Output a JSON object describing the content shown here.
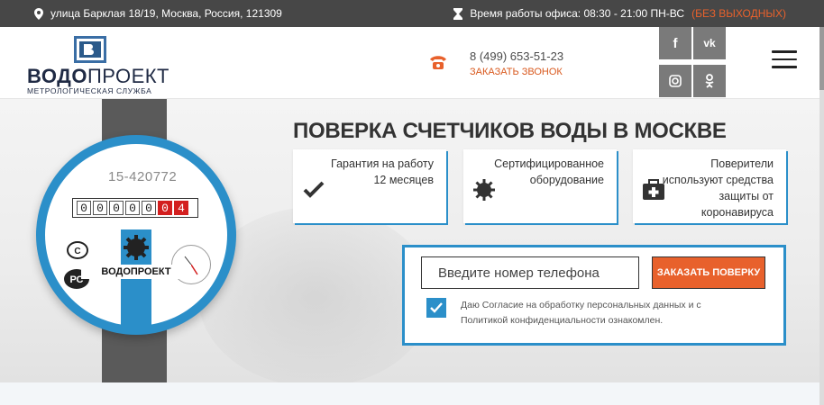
{
  "topbar": {
    "address": "улица Барклая 18/19, Москва, Россия, 121309",
    "hours_label": "Время работы офиса: 08:30 - 21:00 ПН-ВС",
    "hours_note": "(БЕЗ ВЫХОДНЫХ)"
  },
  "header": {
    "logo_name_bold": "ВОДО",
    "logo_name_thin": "ПРОЕКТ",
    "logo_tagline": "МЕТРОЛОГИЧЕСКАЯ СЛУЖБА",
    "phone": "8 (499) 653-51-23",
    "callback_label": "ЗАКАЗАТЬ ЗВОНОК",
    "social": [
      {
        "label": "f",
        "icon": "facebook-icon"
      },
      {
        "label": "vk",
        "icon": "vk-icon"
      },
      {
        "label": "ig",
        "icon": "instagram-icon"
      },
      {
        "label": "ok",
        "icon": "odnoklassniki-icon"
      }
    ]
  },
  "meter": {
    "serial": "15-420772",
    "digits": [
      "0",
      "0",
      "0",
      "0",
      "0",
      "0",
      "4"
    ],
    "brand": "ВОДОПРОЕКТ"
  },
  "hero": {
    "headline": "ПОВЕРКА СЧЕТЧИКОВ ВОДЫ В МОСКВЕ",
    "features": [
      {
        "text": "Гарантия на работу\n12 месяцев",
        "icon": "checkmark-icon"
      },
      {
        "text": "Сертифицированное\nоборудование",
        "icon": "gear-badge-icon"
      },
      {
        "text": "Поверители\nиспользуют средства\nзащиты от\nкоронавируса",
        "icon": "first-aid-kit-icon"
      }
    ]
  },
  "form": {
    "phone_placeholder": "Введите номер телефона",
    "submit_label": "ЗАКАЗАТЬ ПОВЕРКУ",
    "consent_text": "Даю Согласие на обработку персональных данных и с Политикой конфиденциальности ознакомлен.",
    "consent_checked": true
  },
  "colors": {
    "accent_blue": "#2b8fc9",
    "accent_orange": "#e8612c",
    "topbar_bg": "#474747"
  }
}
